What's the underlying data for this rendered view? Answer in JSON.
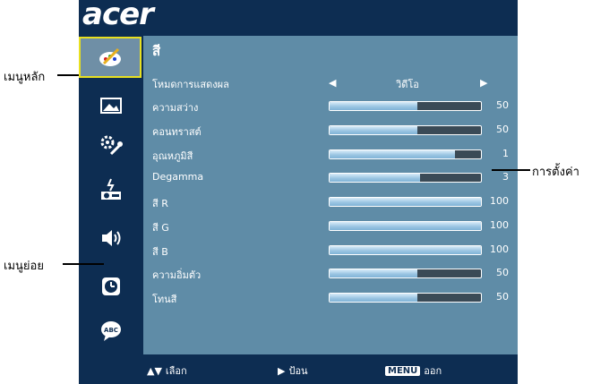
{
  "brand": {
    "logo_text": "acer"
  },
  "sidebar": {
    "items": [
      {
        "icon": "color-palette-icon",
        "selected": true
      },
      {
        "icon": "image-icon",
        "selected": false
      },
      {
        "icon": "settings-tools-icon",
        "selected": false
      },
      {
        "icon": "projector-management-icon",
        "selected": false
      },
      {
        "icon": "speaker-audio-icon",
        "selected": false
      },
      {
        "icon": "clock-timer-icon",
        "selected": false
      },
      {
        "icon": "language-abc-icon",
        "selected": false
      }
    ]
  },
  "panel": {
    "title": "สี",
    "display_mode": {
      "label": "โหมดการแสดงผล",
      "value": "วิดีโอ"
    },
    "settings": [
      {
        "label": "ความสว่าง",
        "value": "50",
        "level": 0.58
      },
      {
        "label": "คอนทราสต์",
        "value": "50",
        "level": 0.58
      },
      {
        "label": "อุณหภูมิสี",
        "value": "1",
        "level": 0.83
      },
      {
        "label": "Degamma",
        "value": "3",
        "level": 0.6
      },
      {
        "label": "สี R",
        "value": "100",
        "level": 1.0
      },
      {
        "label": "สี G",
        "value": "100",
        "level": 1.0
      },
      {
        "label": "สี B",
        "value": "100",
        "level": 1.0
      },
      {
        "label": "ความอิ่มตัว",
        "value": "50",
        "level": 0.58
      },
      {
        "label": "โทนสี",
        "value": "50",
        "level": 0.58
      }
    ]
  },
  "footer": {
    "select_label": "เลือก",
    "enter_label": "ป้อน",
    "menu_key": "MENU",
    "exit_label": "ออก"
  },
  "callouts": {
    "main_menu": "เมนูหลัก",
    "submenu": "เมนูย่อย",
    "settings": "การตั้งค่า"
  },
  "colors": {
    "osd_dark": "#0d2d52",
    "panel": "#5f8ca7",
    "highlight": "#e8e020"
  }
}
